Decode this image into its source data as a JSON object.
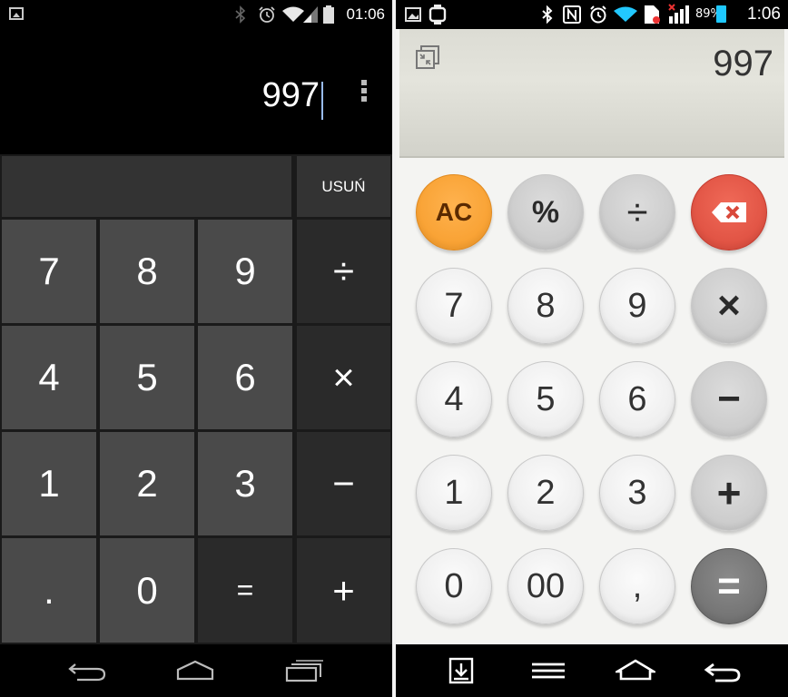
{
  "left_phone": {
    "status_bar": {
      "time": "01:06",
      "icons": [
        "gallery-icon",
        "bluetooth-icon",
        "alarm-icon",
        "wifi-icon",
        "signal-icon",
        "battery-icon"
      ]
    },
    "display": {
      "value": "997",
      "menu_icon": "overflow-menu-icon"
    },
    "delete_label": "USUŃ",
    "keys": {
      "k7": "7",
      "k8": "8",
      "k9": "9",
      "div": "÷",
      "k4": "4",
      "k5": "5",
      "k6": "6",
      "mul": "×",
      "k1": "1",
      "k2": "2",
      "k3": "3",
      "sub": "−",
      "dot": ".",
      "k0": "0",
      "eq": "=",
      "add": "+"
    },
    "nav_icons": [
      "back-icon",
      "home-icon",
      "recents-icon"
    ],
    "colors": {
      "key": "#4a4a4a",
      "op": "#2a2a2a",
      "background": "#000000"
    }
  },
  "right_phone": {
    "status_bar": {
      "time": "1:06",
      "battery_percent": "89%",
      "icons": [
        "gallery-icon",
        "watch-icon",
        "bluetooth-icon",
        "nfc-icon",
        "alarm-icon",
        "wifi-icon",
        "sim-icon",
        "signal-icon",
        "battery-icon"
      ]
    },
    "display": {
      "value": "997",
      "compact_icon": "compact-mode-icon"
    },
    "keys": {
      "ac": "AC",
      "pct": "%",
      "div": "÷",
      "k7": "7",
      "k8": "8",
      "k9": "9",
      "mul": "×",
      "k4": "4",
      "k5": "5",
      "k6": "6",
      "sub": "−",
      "k1": "1",
      "k2": "2",
      "k3": "3",
      "add": "+",
      "k0": "0",
      "k00": "00",
      "comma": ",",
      "eq": "="
    },
    "backspace_icon": "backspace-icon",
    "nav_icons": [
      "download-icon",
      "menu-icon",
      "home-icon",
      "back-icon"
    ],
    "colors": {
      "ac": "#f59a27",
      "backspace": "#d9483a",
      "equals": "#6a6a6a",
      "display": "#dcdcd4"
    }
  }
}
